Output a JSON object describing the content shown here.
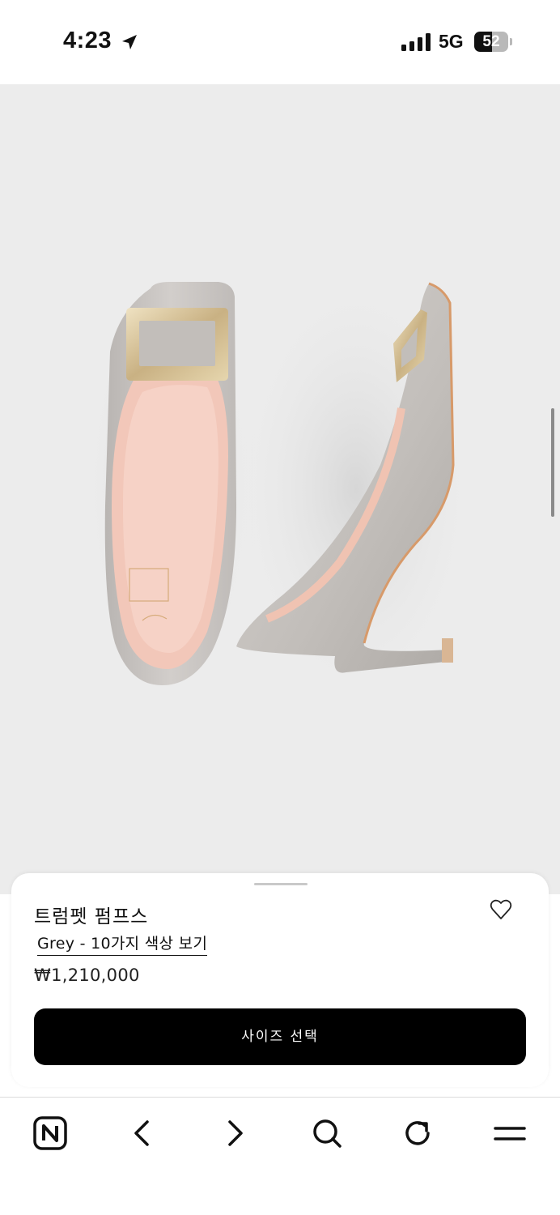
{
  "status_bar": {
    "time": "4:23",
    "network": "5G",
    "battery_percent": 52,
    "battery_label": "52"
  },
  "product": {
    "name": "트럼펫 펌프스",
    "color_link": "Grey - 10가지 색상 보기",
    "price": "₩1,210,000",
    "size_button_label": "사이즈 선택"
  },
  "icons": {
    "location": "location-arrow-icon",
    "signal": "cell-signal-icon",
    "wishlist": "heart-outline-icon",
    "toolbar": [
      "naver-n-icon",
      "back-chevron-icon",
      "forward-chevron-icon",
      "search-icon",
      "reload-icon",
      "menu-icon"
    ]
  },
  "colors": {
    "image_bg": "#ececec",
    "button_bg": "#000000",
    "shoe_grey": "#c8c4c1",
    "shoe_lining": "#f2c9bd",
    "buckle_gold": "#d9c49a"
  }
}
